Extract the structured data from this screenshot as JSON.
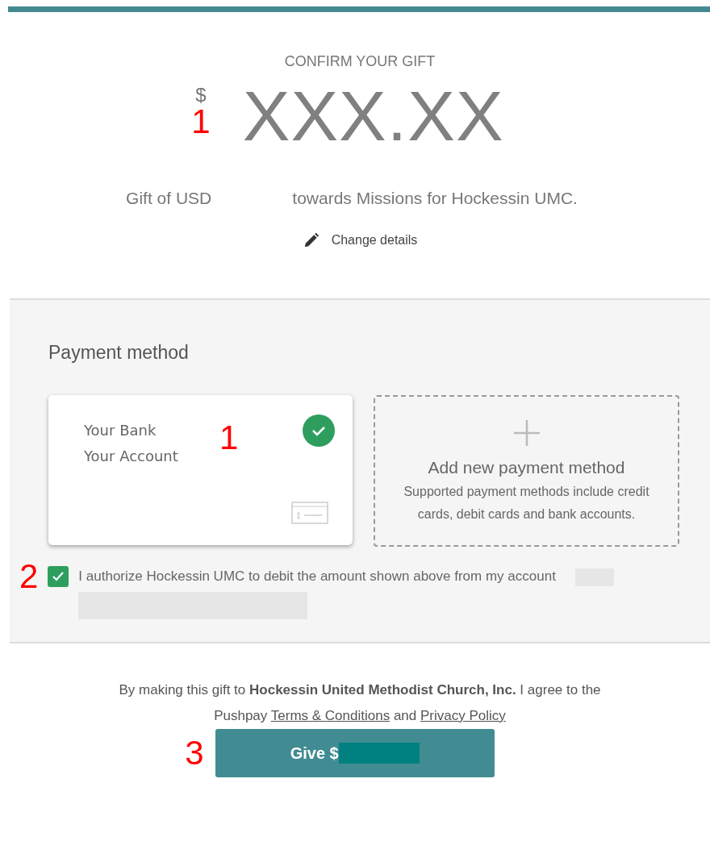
{
  "header": {
    "title": "CONFIRM YOUR GIFT",
    "currency_symbol": "$",
    "amount": "XXX.XX",
    "summary_start": "Gift of USD",
    "summary_end": "towards Missions for Hockessin UMC.",
    "change_link": "Change details"
  },
  "payment": {
    "title": "Payment method",
    "methods": [
      {
        "kind": "account",
        "lines": [
          "Your Bank",
          "Your Account"
        ],
        "selected": true
      },
      {
        "kind": "add",
        "title": "Add new payment method",
        "description": "Supported payment methods include credit cards, debit cards and bank accounts."
      }
    ],
    "authorization": {
      "text": "I authorize Hockessin UMC to debit the amount shown above from my account",
      "checked": true
    }
  },
  "agreement": [
    {
      "kind": "text",
      "text": "By making this gift to **Hockessin United Methodist Church, Inc.** I agree to the Pushpay"
    },
    {
      "kind": "link",
      "text": "Terms & Conditions"
    },
    {
      "kind": "text",
      "text": "and"
    },
    {
      "kind": "link",
      "text": "Privacy Policy"
    }
  ],
  "give_button": {
    "label": "Give $"
  },
  "annotations": {
    "amount": "1",
    "payment_card": "1",
    "authorization": "2",
    "give_button": "3"
  }
}
